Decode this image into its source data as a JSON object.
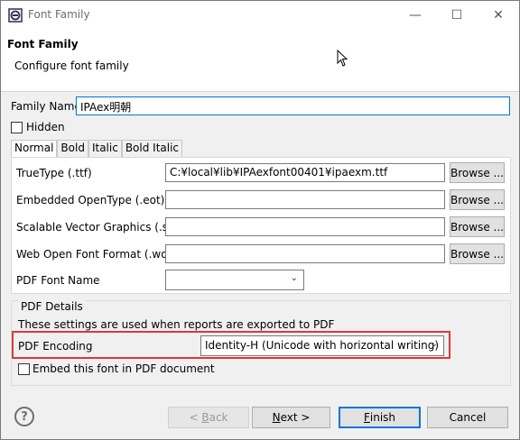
{
  "window": {
    "title": "Font Family",
    "controls": {
      "minimize": "—",
      "maximize": "☐",
      "close": "✕"
    }
  },
  "header": {
    "title": "Font Family",
    "subtitle": "Configure font family"
  },
  "family": {
    "label": "Family Name",
    "value": "IPAex明朝",
    "hidden_label": "Hidden",
    "hidden_checked": false
  },
  "tabs": [
    {
      "label": "Normal",
      "active": true
    },
    {
      "label": "Bold",
      "active": false
    },
    {
      "label": "Italic",
      "active": false
    },
    {
      "label": "Bold Italic",
      "active": false
    }
  ],
  "fields": {
    "truetype": {
      "label": "TrueType (.ttf)",
      "value": "C:¥local¥lib¥IPAexfont00401¥ipaexm.ttf",
      "browse": "Browse ..."
    },
    "eot": {
      "label": "Embedded OpenType (.eot)",
      "value": "",
      "browse": "Browse ..."
    },
    "svg": {
      "label": "Scalable Vector Graphics (.svg)",
      "value": "",
      "browse": "Browse ..."
    },
    "woff": {
      "label": "Web Open Font Format (.woff)",
      "value": "",
      "browse": "Browse ..."
    },
    "pdf_font_name": {
      "label": "PDF Font Name",
      "value": ""
    }
  },
  "pdf": {
    "group_title": "PDF Details",
    "note": "These settings are used when reports are exported to PDF",
    "encoding_label": "PDF Encoding",
    "encoding_value": "Identity-H (Unicode with horizontal writing)",
    "embed_label": "Embed this font in PDF document",
    "embed_checked": false
  },
  "footer": {
    "help": "?",
    "back": {
      "prefix": "< ",
      "mnemonic": "B",
      "rest": "ack"
    },
    "next": {
      "mnemonic": "N",
      "rest": "ext >"
    },
    "finish": {
      "mnemonic": "F",
      "rest": "inish"
    },
    "cancel": "Cancel"
  },
  "colors": {
    "highlight": "#d93a3a",
    "focus": "#0078d7"
  }
}
